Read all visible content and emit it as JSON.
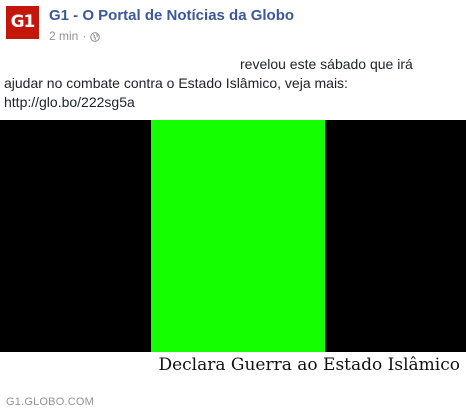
{
  "post": {
    "logo_text": "G1",
    "page_name": "G1 - O Portal de Notícias da Globo",
    "timestamp": "2 min",
    "separator": "·",
    "privacy_icon": "globe-icon",
    "text_line1": "revelou este sábado que irá",
    "text_line2": "ajudar no combate contra o Estado Islâmico, veja mais:",
    "text_line3": "http://glo.bo/222sg5a"
  },
  "image": {
    "caption": "Declara Guerra ao Estado Islâmico",
    "colors": {
      "left": "#000000",
      "center": "#14ff00",
      "right": "#000000"
    }
  },
  "link": {
    "domain": "G1.GLOBO.COM"
  },
  "colors": {
    "brand_red": "#c4170c",
    "link_blue": "#3b5998",
    "meta_gray": "#90949c"
  }
}
